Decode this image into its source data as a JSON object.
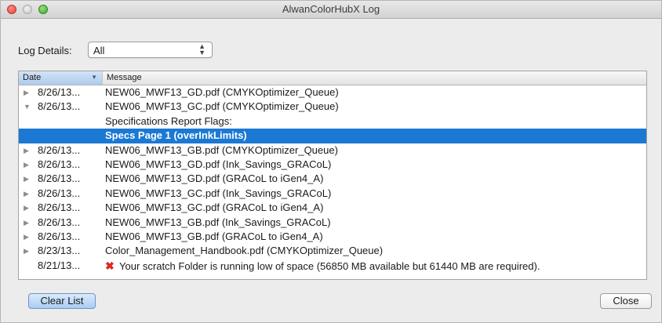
{
  "window": {
    "title": "AlwanColorHubX Log"
  },
  "filter": {
    "label": "Log Details:",
    "selected": "All"
  },
  "table": {
    "headers": {
      "date": "Date",
      "message": "Message"
    },
    "rows": [
      {
        "expander": "collapsed",
        "date": "8/26/13...",
        "message": "NEW06_MWF13_GD.pdf (CMYKOptimizer_Queue)"
      },
      {
        "expander": "expanded",
        "date": "8/26/13...",
        "message": "NEW06_MWF13_GC.pdf (CMYKOptimizer_Queue)"
      },
      {
        "expander": "none",
        "date": "",
        "message": "Specifications Report Flags:"
      },
      {
        "expander": "none",
        "date": "",
        "message": "Specs Page 1 (overInkLimits)",
        "selected": true
      },
      {
        "expander": "collapsed",
        "date": "8/26/13...",
        "message": "NEW06_MWF13_GB.pdf (CMYKOptimizer_Queue)"
      },
      {
        "expander": "collapsed",
        "date": "8/26/13...",
        "message": "NEW06_MWF13_GD.pdf (Ink_Savings_GRACoL)"
      },
      {
        "expander": "collapsed",
        "date": "8/26/13...",
        "message": "NEW06_MWF13_GD.pdf (GRACoL to iGen4_A)"
      },
      {
        "expander": "collapsed",
        "date": "8/26/13...",
        "message": "NEW06_MWF13_GC.pdf (Ink_Savings_GRACoL)"
      },
      {
        "expander": "collapsed",
        "date": "8/26/13...",
        "message": "NEW06_MWF13_GC.pdf (GRACoL to iGen4_A)"
      },
      {
        "expander": "collapsed",
        "date": "8/26/13...",
        "message": "NEW06_MWF13_GB.pdf (Ink_Savings_GRACoL)"
      },
      {
        "expander": "collapsed",
        "date": "8/26/13...",
        "message": "NEW06_MWF13_GB.pdf (GRACoL to iGen4_A)"
      },
      {
        "expander": "collapsed",
        "date": "8/23/13...",
        "message": "Color_Management_Handbook.pdf (CMYKOptimizer_Queue)"
      },
      {
        "expander": "none",
        "date": "8/21/13...",
        "message": "Your scratch Folder is running low of space (56850 MB available but 61440 MB are required).",
        "icon": "error-x-icon"
      }
    ]
  },
  "buttons": {
    "clear": "Clear List",
    "close": "Close"
  },
  "colors": {
    "selection": "#1b79d4",
    "error": "#d82a1e"
  }
}
